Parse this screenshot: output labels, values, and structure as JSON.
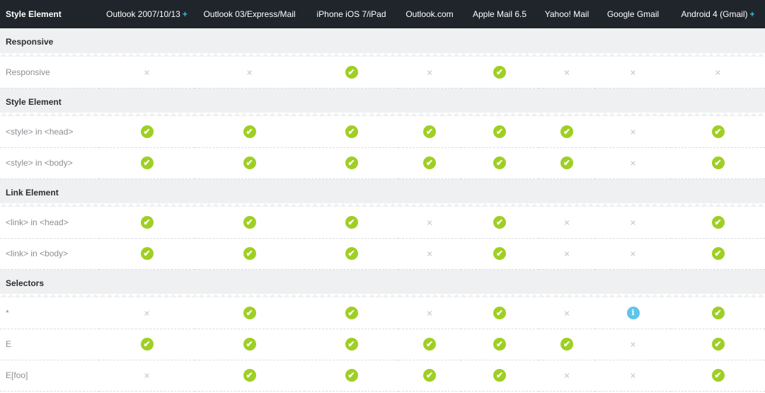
{
  "header": {
    "title": "Style Element",
    "clients": [
      {
        "name": "Outlook 2007/10/13",
        "plus": "+"
      },
      {
        "name": "Outlook 03/Express/Mail",
        "plus": ""
      },
      {
        "name": "iPhone iOS 7/iPad",
        "plus": ""
      },
      {
        "name": "Outlook.com",
        "plus": ""
      },
      {
        "name": "Apple Mail 6.5",
        "plus": ""
      },
      {
        "name": "Yahoo! Mail",
        "plus": ""
      },
      {
        "name": "Google Gmail",
        "plus": ""
      },
      {
        "name": "Android 4 (Gmail)",
        "plus": "+"
      }
    ]
  },
  "icons": {
    "yes": "check-icon",
    "no": "cross-icon",
    "info": "info-icon",
    "yes_glyph": "✔",
    "no_glyph": "✕",
    "info_glyph": "i"
  },
  "colors": {
    "header_bg": "#1f252b",
    "section_bg": "#eef0f2",
    "yes": "#9fcf24",
    "info": "#5fc4e9",
    "plus": "#41b8e8"
  },
  "sections": [
    {
      "title": "Responsive",
      "rows": [
        {
          "label": "Responsive",
          "support": [
            "no",
            "no",
            "yes",
            "no",
            "yes",
            "no",
            "no",
            "no"
          ]
        }
      ]
    },
    {
      "title": "Style Element",
      "rows": [
        {
          "label": "<style> in <head>",
          "support": [
            "yes",
            "yes",
            "yes",
            "yes",
            "yes",
            "yes",
            "no",
            "yes"
          ]
        },
        {
          "label": "<style> in <body>",
          "support": [
            "yes",
            "yes",
            "yes",
            "yes",
            "yes",
            "yes",
            "no",
            "yes"
          ]
        }
      ]
    },
    {
      "title": "Link Element",
      "rows": [
        {
          "label": "<link> in <head>",
          "support": [
            "yes",
            "yes",
            "yes",
            "no",
            "yes",
            "no",
            "no",
            "yes"
          ]
        },
        {
          "label": "<link> in <body>",
          "support": [
            "yes",
            "yes",
            "yes",
            "no",
            "yes",
            "no",
            "no",
            "yes"
          ]
        }
      ]
    },
    {
      "title": "Selectors",
      "rows": [
        {
          "label": "*",
          "support": [
            "no",
            "yes",
            "yes",
            "no",
            "yes",
            "no",
            "info",
            "yes"
          ]
        },
        {
          "label": "E",
          "support": [
            "yes",
            "yes",
            "yes",
            "yes",
            "yes",
            "yes",
            "no",
            "yes"
          ]
        },
        {
          "label": "E[foo]",
          "support": [
            "no",
            "yes",
            "yes",
            "yes",
            "yes",
            "no",
            "no",
            "yes"
          ]
        }
      ]
    }
  ]
}
